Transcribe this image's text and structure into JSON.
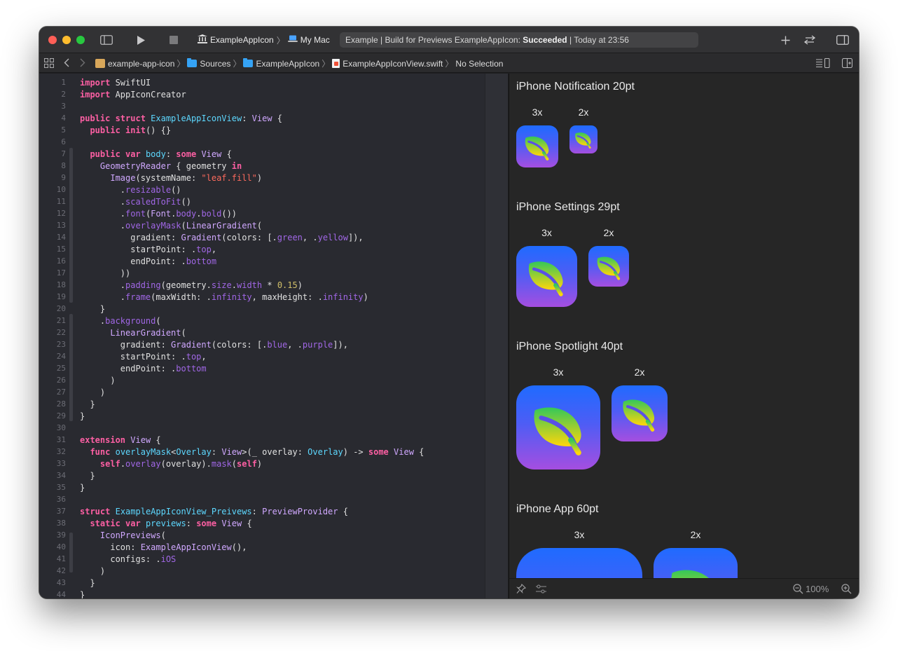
{
  "toolbar": {
    "scheme_target": "ExampleAppIcon",
    "scheme_separator": "〉",
    "destination": "My Mac",
    "status_prefix": "Example | Build for Previews ExampleAppIcon:",
    "status_result": "Succeeded",
    "status_suffix": "| Today at 23:56"
  },
  "jumpbar": {
    "items": [
      "example-app-icon",
      "Sources",
      "ExampleAppIcon",
      "ExampleAppIconView.swift",
      "No Selection"
    ]
  },
  "code": [
    {
      "n": "1",
      "t": [
        [
          "kw",
          "import"
        ],
        [
          "pl",
          " SwiftUI"
        ]
      ]
    },
    {
      "n": "2",
      "t": [
        [
          "kw",
          "import"
        ],
        [
          "pl",
          " AppIconCreator"
        ]
      ]
    },
    {
      "n": "3",
      "t": []
    },
    {
      "n": "4",
      "t": [
        [
          "kw",
          "public struct"
        ],
        [
          "pl",
          " "
        ],
        [
          "ty",
          "ExampleAppIconView"
        ],
        [
          "pl",
          ": "
        ],
        [
          "ty2",
          "View"
        ],
        [
          "pl",
          " {"
        ]
      ]
    },
    {
      "n": "5",
      "t": [
        [
          "pl",
          "  "
        ],
        [
          "kw",
          "public init"
        ],
        [
          "pl",
          "() {}"
        ]
      ]
    },
    {
      "n": "6",
      "t": []
    },
    {
      "n": "7",
      "t": [
        [
          "pl",
          "  "
        ],
        [
          "kw",
          "public var"
        ],
        [
          "pl",
          " "
        ],
        [
          "ty",
          "body"
        ],
        [
          "pl",
          ": "
        ],
        [
          "kw",
          "some"
        ],
        [
          "pl",
          " "
        ],
        [
          "ty2",
          "View"
        ],
        [
          "pl",
          " {"
        ]
      ]
    },
    {
      "n": "8",
      "t": [
        [
          "pl",
          "    "
        ],
        [
          "ty2",
          "GeometryReader"
        ],
        [
          "pl",
          " { geometry "
        ],
        [
          "kw",
          "in"
        ]
      ]
    },
    {
      "n": "9",
      "t": [
        [
          "pl",
          "      "
        ],
        [
          "ty2",
          "Image"
        ],
        [
          "pl",
          "(systemName: "
        ],
        [
          "str",
          "\"leaf.fill\""
        ],
        [
          "pl",
          ")"
        ]
      ]
    },
    {
      "n": "10",
      "t": [
        [
          "pl",
          "        ."
        ],
        [
          "fn",
          "resizable"
        ],
        [
          "pl",
          "()"
        ]
      ]
    },
    {
      "n": "11",
      "t": [
        [
          "pl",
          "        ."
        ],
        [
          "fn",
          "scaledToFit"
        ],
        [
          "pl",
          "()"
        ]
      ]
    },
    {
      "n": "12",
      "t": [
        [
          "pl",
          "        ."
        ],
        [
          "fn",
          "font"
        ],
        [
          "pl",
          "("
        ],
        [
          "ty2",
          "Font"
        ],
        [
          "pl",
          "."
        ],
        [
          "fn",
          "body"
        ],
        [
          "pl",
          "."
        ],
        [
          "fn",
          "bold"
        ],
        [
          "pl",
          "())"
        ]
      ]
    },
    {
      "n": "13",
      "t": [
        [
          "pl",
          "        ."
        ],
        [
          "fn",
          "overlayMask"
        ],
        [
          "pl",
          "("
        ],
        [
          "ty2",
          "LinearGradient"
        ],
        [
          "pl",
          "("
        ]
      ]
    },
    {
      "n": "14",
      "t": [
        [
          "pl",
          "          gradient: "
        ],
        [
          "ty2",
          "Gradient"
        ],
        [
          "pl",
          "(colors: [."
        ],
        [
          "fn",
          "green"
        ],
        [
          "pl",
          ", ."
        ],
        [
          "fn",
          "yellow"
        ],
        [
          "pl",
          "]),"
        ]
      ]
    },
    {
      "n": "15",
      "t": [
        [
          "pl",
          "          startPoint: ."
        ],
        [
          "fn",
          "top"
        ],
        [
          "pl",
          ","
        ]
      ]
    },
    {
      "n": "16",
      "t": [
        [
          "pl",
          "          endPoint: ."
        ],
        [
          "fn",
          "bottom"
        ]
      ]
    },
    {
      "n": "17",
      "t": [
        [
          "pl",
          "        ))"
        ]
      ]
    },
    {
      "n": "18",
      "t": [
        [
          "pl",
          "        ."
        ],
        [
          "fn",
          "padding"
        ],
        [
          "pl",
          "(geometry."
        ],
        [
          "fn",
          "size"
        ],
        [
          "pl",
          "."
        ],
        [
          "fn",
          "width"
        ],
        [
          "pl",
          " * "
        ],
        [
          "num",
          "0.15"
        ],
        [
          "pl",
          ")"
        ]
      ]
    },
    {
      "n": "19",
      "t": [
        [
          "pl",
          "        ."
        ],
        [
          "fn",
          "frame"
        ],
        [
          "pl",
          "(maxWidth: ."
        ],
        [
          "fn",
          "infinity"
        ],
        [
          "pl",
          ", maxHeight: ."
        ],
        [
          "fn",
          "infinity"
        ],
        [
          "pl",
          ")"
        ]
      ]
    },
    {
      "n": "20",
      "t": [
        [
          "pl",
          "    }"
        ]
      ]
    },
    {
      "n": "21",
      "t": [
        [
          "pl",
          "    ."
        ],
        [
          "fn",
          "background"
        ],
        [
          "pl",
          "("
        ]
      ]
    },
    {
      "n": "22",
      "t": [
        [
          "pl",
          "      "
        ],
        [
          "ty2",
          "LinearGradient"
        ],
        [
          "pl",
          "("
        ]
      ]
    },
    {
      "n": "23",
      "t": [
        [
          "pl",
          "        gradient: "
        ],
        [
          "ty2",
          "Gradient"
        ],
        [
          "pl",
          "(colors: [."
        ],
        [
          "fn",
          "blue"
        ],
        [
          "pl",
          ", ."
        ],
        [
          "fn",
          "purple"
        ],
        [
          "pl",
          "]),"
        ]
      ]
    },
    {
      "n": "24",
      "t": [
        [
          "pl",
          "        startPoint: ."
        ],
        [
          "fn",
          "top"
        ],
        [
          "pl",
          ","
        ]
      ]
    },
    {
      "n": "25",
      "t": [
        [
          "pl",
          "        endPoint: ."
        ],
        [
          "fn",
          "bottom"
        ]
      ]
    },
    {
      "n": "26",
      "t": [
        [
          "pl",
          "      )"
        ]
      ]
    },
    {
      "n": "27",
      "t": [
        [
          "pl",
          "    )"
        ]
      ]
    },
    {
      "n": "28",
      "t": [
        [
          "pl",
          "  }"
        ]
      ]
    },
    {
      "n": "29",
      "t": [
        [
          "pl",
          "}"
        ]
      ]
    },
    {
      "n": "30",
      "t": []
    },
    {
      "n": "31",
      "t": [
        [
          "kw",
          "extension"
        ],
        [
          "pl",
          " "
        ],
        [
          "ty2",
          "View"
        ],
        [
          "pl",
          " {"
        ]
      ]
    },
    {
      "n": "32",
      "t": [
        [
          "pl",
          "  "
        ],
        [
          "kw",
          "func"
        ],
        [
          "pl",
          " "
        ],
        [
          "ty",
          "overlayMask"
        ],
        [
          "pl",
          "<"
        ],
        [
          "ty",
          "Overlay"
        ],
        [
          "pl",
          ": "
        ],
        [
          "ty2",
          "View"
        ],
        [
          "pl",
          ">(_ overlay: "
        ],
        [
          "ty",
          "Overlay"
        ],
        [
          "pl",
          ") -> "
        ],
        [
          "kw",
          "some"
        ],
        [
          "pl",
          " "
        ],
        [
          "ty2",
          "View"
        ],
        [
          "pl",
          " {"
        ]
      ]
    },
    {
      "n": "33",
      "t": [
        [
          "pl",
          "    "
        ],
        [
          "kw",
          "self"
        ],
        [
          "pl",
          "."
        ],
        [
          "fn",
          "overlay"
        ],
        [
          "pl",
          "(overlay)."
        ],
        [
          "fn",
          "mask"
        ],
        [
          "pl",
          "("
        ],
        [
          "kw",
          "self"
        ],
        [
          "pl",
          ")"
        ]
      ]
    },
    {
      "n": "34",
      "t": [
        [
          "pl",
          "  }"
        ]
      ]
    },
    {
      "n": "35",
      "t": [
        [
          "pl",
          "}"
        ]
      ]
    },
    {
      "n": "36",
      "t": []
    },
    {
      "n": "37",
      "t": [
        [
          "kw",
          "struct"
        ],
        [
          "pl",
          " "
        ],
        [
          "ty",
          "ExampleAppIconView_Preivews"
        ],
        [
          "pl",
          ": "
        ],
        [
          "ty2",
          "PreviewProvider"
        ],
        [
          "pl",
          " {"
        ]
      ]
    },
    {
      "n": "38",
      "t": [
        [
          "pl",
          "  "
        ],
        [
          "kw",
          "static var"
        ],
        [
          "pl",
          " "
        ],
        [
          "ty",
          "previews"
        ],
        [
          "pl",
          ": "
        ],
        [
          "kw",
          "some"
        ],
        [
          "pl",
          " "
        ],
        [
          "ty2",
          "View"
        ],
        [
          "pl",
          " {"
        ]
      ]
    },
    {
      "n": "39",
      "t": [
        [
          "pl",
          "    "
        ],
        [
          "ty2",
          "IconPreviews"
        ],
        [
          "pl",
          "("
        ]
      ]
    },
    {
      "n": "40",
      "t": [
        [
          "pl",
          "      icon: "
        ],
        [
          "ty2",
          "ExampleAppIconView"
        ],
        [
          "pl",
          "(),"
        ]
      ]
    },
    {
      "n": "41",
      "t": [
        [
          "pl",
          "      configs: ."
        ],
        [
          "fn",
          "iOS"
        ]
      ]
    },
    {
      "n": "42",
      "t": [
        [
          "pl",
          "    )"
        ]
      ]
    },
    {
      "n": "43",
      "t": [
        [
          "pl",
          "  }"
        ]
      ]
    },
    {
      "n": "44",
      "t": [
        [
          "pl",
          "}"
        ]
      ]
    }
  ],
  "preview": {
    "sections": [
      {
        "title": "iPhone Notification 20pt",
        "scales": [
          "3x",
          "2x"
        ]
      },
      {
        "title": "iPhone Settings 29pt",
        "scales": [
          "3x",
          "2x"
        ]
      },
      {
        "title": "iPhone Spotlight 40pt",
        "scales": [
          "3x",
          "2x"
        ]
      },
      {
        "title": "iPhone App 60pt",
        "scales": [
          "3x",
          "2x"
        ]
      }
    ],
    "zoom": "100%"
  },
  "icons": [
    "sidebar-toggle-icon",
    "play-icon",
    "stop-icon",
    "scheme-icon",
    "mac-icon",
    "plus-icon",
    "swap-icon",
    "inspector-icon",
    "grid-icon",
    "back-icon",
    "forward-icon",
    "adjust-editor-icon",
    "add-editor-icon",
    "pin-icon",
    "variants-icon",
    "zoom-out-icon",
    "zoom-in-icon",
    "leaf-icon"
  ],
  "colors": {
    "background_gradient_top": "#1f6bff",
    "background_gradient_bottom": "#a54ee0",
    "leaf_gradient_top": "#34c759",
    "leaf_gradient_bottom": "#ffd60a",
    "keyword": "#fc5fa3",
    "type": "#5dd8ff",
    "string": "#fc6a5d"
  }
}
